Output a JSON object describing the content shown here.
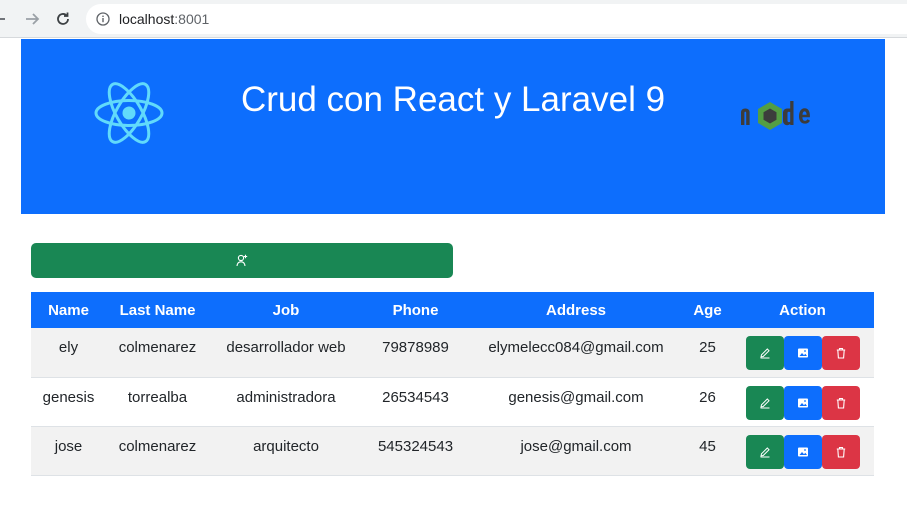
{
  "browser": {
    "url_host": "localhost",
    "url_port": ":8001",
    "icons": [
      "back-arrow-icon",
      "forward-arrow-icon",
      "reload-icon",
      "info-icon"
    ]
  },
  "header": {
    "title": "Crud con React y Laravel 9",
    "background": "#0d6efd",
    "logos": [
      "react-logo",
      "node-logo"
    ]
  },
  "add_button": {
    "icon": "add-user-icon",
    "color": "#198754"
  },
  "table": {
    "columns": [
      "Name",
      "Last Name",
      "Job",
      "Phone",
      "Address",
      "Age",
      "Action"
    ],
    "rows": [
      {
        "name": "ely",
        "last_name": "colmenarez",
        "job": "desarrollador web",
        "phone": "79878989",
        "address": "elymelecc084@gmail.com",
        "age": "25"
      },
      {
        "name": "genesis",
        "last_name": "torrealba",
        "job": "administradora",
        "phone": "26534543",
        "address": "genesis@gmail.com",
        "age": "26"
      },
      {
        "name": "jose",
        "last_name": "colmenarez",
        "job": "arquitecto",
        "phone": "545324543",
        "address": "jose@gmail.com",
        "age": "45"
      }
    ],
    "action_icons": [
      "edit-icon",
      "image-icon",
      "trash-icon"
    ],
    "colors": {
      "edit": "#198754",
      "image": "#0d6efd",
      "delete": "#dc3545",
      "header": "#0d6efd"
    }
  }
}
